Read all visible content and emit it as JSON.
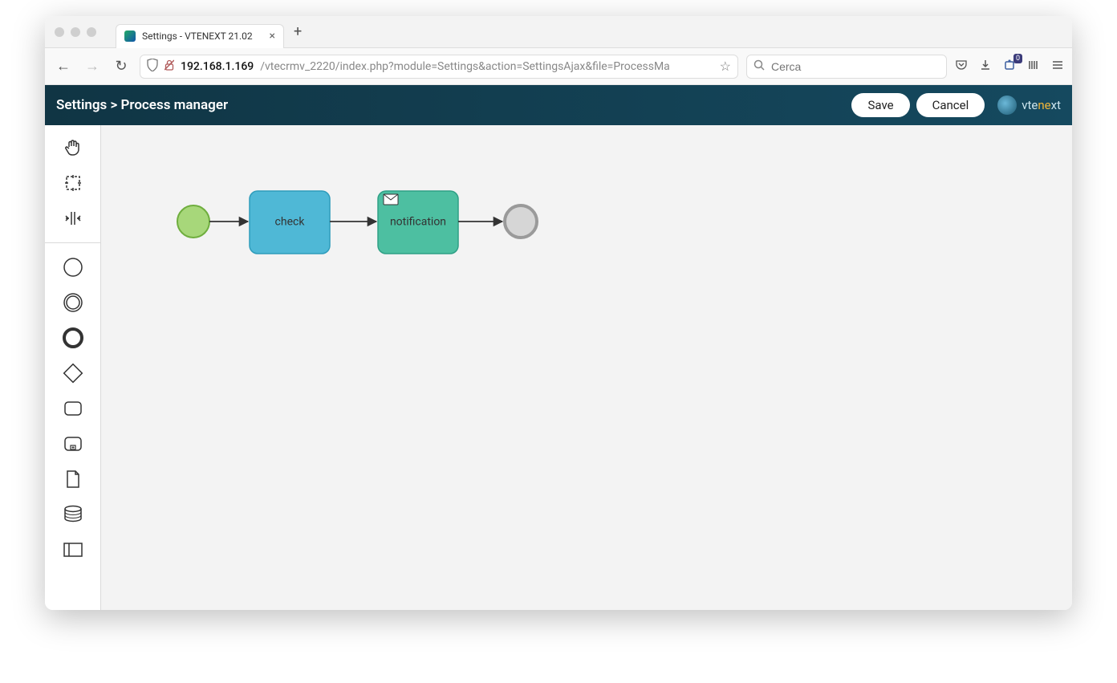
{
  "tab": {
    "title": "Settings - VTENEXT 21.02"
  },
  "url": {
    "host": "192.168.1.169",
    "path": "/vtecrmv_2220/index.php?module=Settings&action=SettingsAjax&file=ProcessMa"
  },
  "search": {
    "placeholder": "Cerca"
  },
  "extension_badge": "0",
  "breadcrumb": "Settings > Process manager",
  "buttons": {
    "save": "Save",
    "cancel": "Cancel"
  },
  "logo": {
    "text_pre": "vte",
    "text_suf": "next"
  },
  "diagram": {
    "nodes": {
      "check": "check",
      "notification": "notification"
    }
  }
}
